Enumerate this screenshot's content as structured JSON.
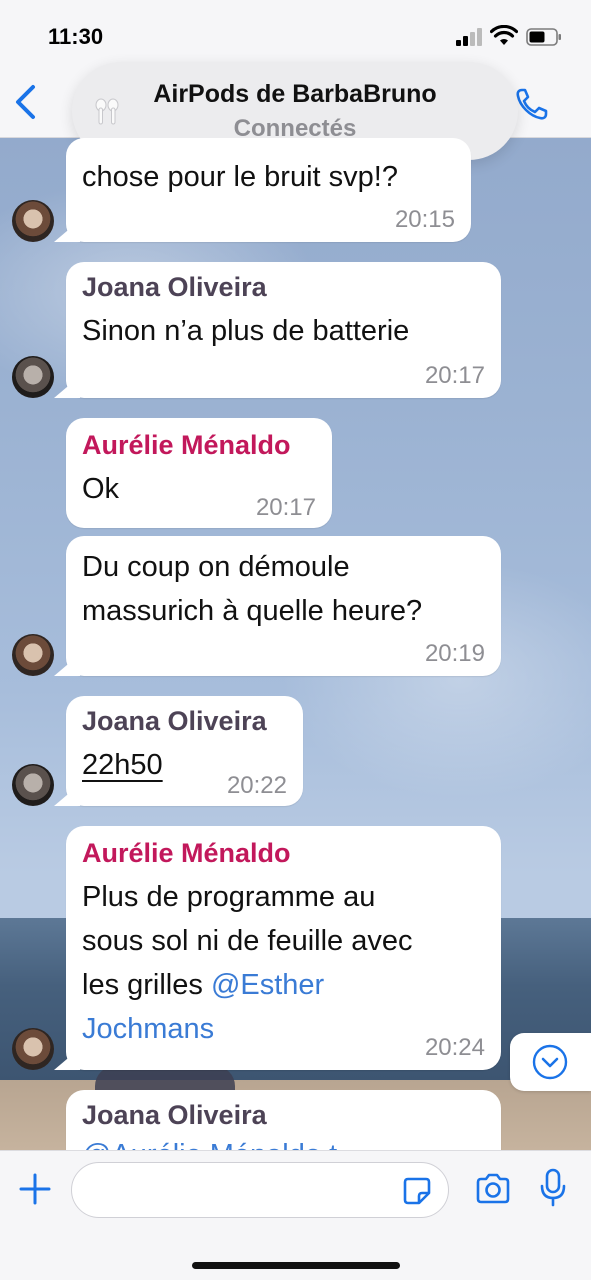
{
  "status_bar": {
    "time": "11:30"
  },
  "airpods_banner": {
    "title": "AirPods de BarbaBruno",
    "subtitle": "Connectés"
  },
  "messages": [
    {
      "sender": "",
      "lines": [
        "chose pour le bruit svp!?"
      ],
      "time": "20:15"
    },
    {
      "sender": "Joana Oliveira",
      "lines": [
        "Sinon n’a plus de batterie"
      ],
      "time": "20:17"
    },
    {
      "sender": "Aurélie Ménaldo",
      "lines": [
        "Ok"
      ],
      "time": "20:17"
    },
    {
      "sender": "",
      "lines": [
        "Du coup on démoule",
        "massurich à quelle heure?"
      ],
      "time": "20:19"
    },
    {
      "sender": "Joana Oliveira",
      "lines": [
        "22h50"
      ],
      "time": "20:22"
    },
    {
      "sender": "Aurélie Ménaldo",
      "lines": [
        "Plus de programme au",
        "sous sol ni de feuille avec",
        "les grilles "
      ],
      "mention_part1": "@Esther",
      "mention_part2": "Jochmans",
      "time": "20:24"
    },
    {
      "sender": "Joana Oliveira",
      "lines": [
        "@Aurélie Ménaldo t"
      ],
      "time": ""
    }
  ],
  "composer": {
    "placeholder": ""
  },
  "colors": {
    "accent": "#3a7bd5",
    "aurelie_name": "#c2185b",
    "joana_name": "#4d4356"
  },
  "icons": [
    "back-icon",
    "phone-icon",
    "airpods-icon",
    "chevron-down-icon",
    "plus-icon",
    "sticker-icon",
    "camera-icon",
    "mic-icon"
  ]
}
